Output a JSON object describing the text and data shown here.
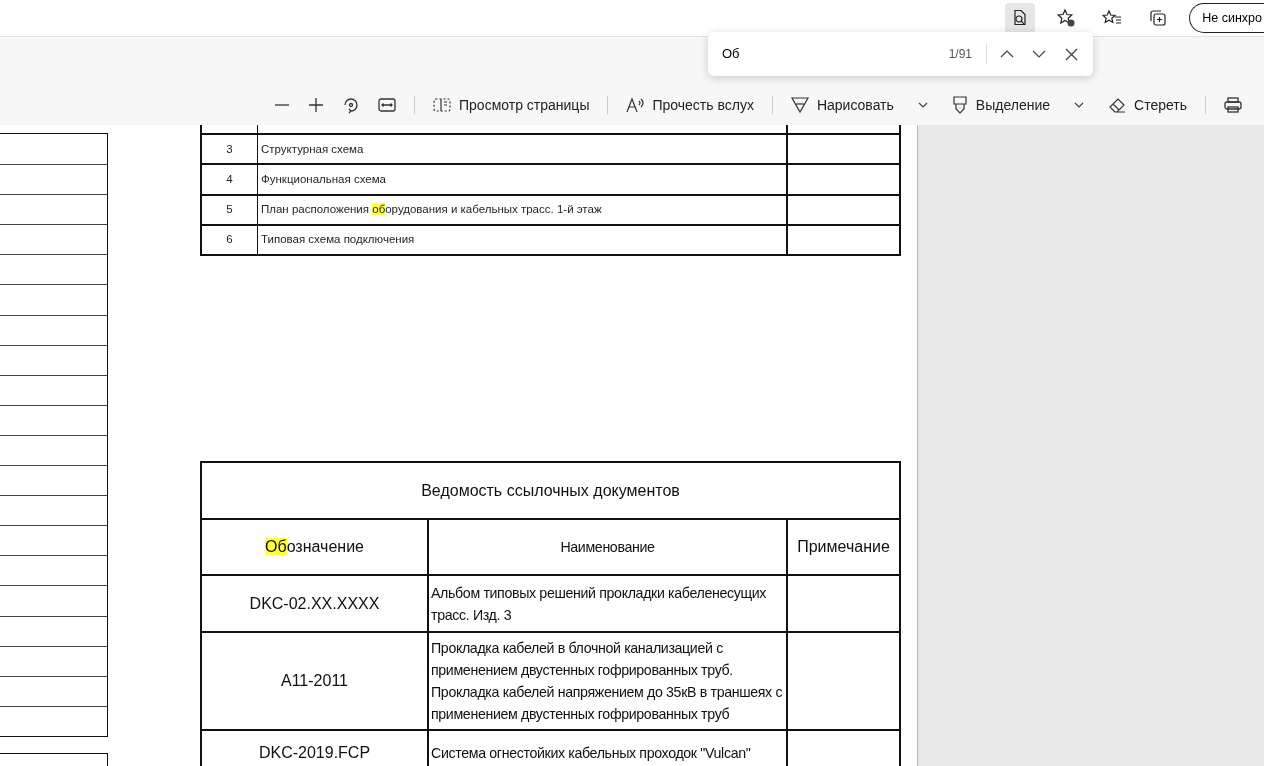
{
  "browser_bar": {
    "profile_button": "Не синхро"
  },
  "find_bar": {
    "value": "Об",
    "count": "1/91"
  },
  "toolbar": {
    "tools": [
      {
        "label": "Просмотр страницы",
        "dropdown": false
      },
      {
        "label": "Прочесть вслух",
        "dropdown": false
      },
      {
        "label": "Нарисовать",
        "dropdown": true
      },
      {
        "label": "Выделение",
        "dropdown": true
      },
      {
        "label": "Стереть",
        "dropdown": false
      }
    ]
  },
  "drawings_list": {
    "rows": [
      {
        "number": "3",
        "title": "Структурная схема"
      },
      {
        "number": "4",
        "title": "Функциональная схема"
      },
      {
        "number": "5",
        "title": [
          {
            "text": "План расположения ",
            "highlight": false
          },
          {
            "text": "об",
            "highlight": true
          },
          {
            "text": "орудования и кабельных трасс. 1-й этаж",
            "highlight": false
          }
        ]
      },
      {
        "number": "6",
        "title": "Типовая схема подключения"
      }
    ]
  },
  "references": {
    "title": "Ведомость ссылочных документов",
    "columns": [
      [
        {
          "text": "Об",
          "highlight": true
        },
        {
          "text": "означение",
          "highlight": false
        }
      ],
      "Наименование",
      "Примечание"
    ],
    "rows": [
      {
        "designation": "DKC-02.XX.XXXX",
        "name": "Альбом типовых решений прокладки кабеленесущих трасс. Изд. 3"
      },
      {
        "designation": "А11-2011",
        "name": "Прокладка кабелей в блочной канализацией с применением двустенных гофрированных труб. Прокладка кабелей напряжением до 35кВ в траншеях с применением двустенных гофрированных труб"
      },
      {
        "designation": "DKC-2019.FCP",
        "name": "Система огнестойких кабельных проходок \"Vulcan\""
      }
    ]
  }
}
